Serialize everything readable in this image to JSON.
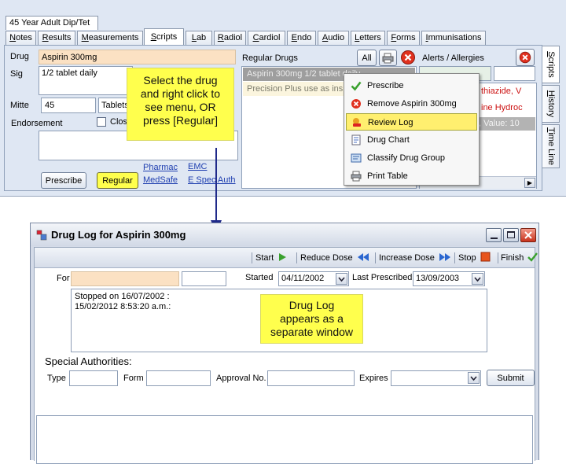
{
  "patient_tab": "45 Year Adult Dip/Tet",
  "clinical_tabs": [
    {
      "label": "Notes",
      "active": false
    },
    {
      "label": "Results",
      "active": false
    },
    {
      "label": "Measurements",
      "active": false
    },
    {
      "label": "Scripts",
      "active": true
    },
    {
      "label": "Lab",
      "active": false
    },
    {
      "label": "Radiol",
      "active": false
    },
    {
      "label": "Cardiol",
      "active": false
    },
    {
      "label": "Endo",
      "active": false
    },
    {
      "label": "Audio",
      "active": false
    },
    {
      "label": "Letters",
      "active": false
    },
    {
      "label": "Forms",
      "active": false
    },
    {
      "label": "Immunisations",
      "active": false
    }
  ],
  "side_tabs": [
    "Scripts",
    "History",
    "Time Line"
  ],
  "script_form": {
    "drug_label": "Drug",
    "drug_value": "Aspirin  300mg",
    "sig_label": "Sig",
    "sig_value": "1/2 tablet daily",
    "mitte_label": "Mitte",
    "mitte_value": "45",
    "unit_value": "Tablets",
    "endorsement_label": "Endorsement",
    "close_label": "Clos",
    "prescribe_button": "Prescribe",
    "regular_button": "Regular",
    "links": [
      "Pharmac",
      "MedSafe",
      "EMC",
      "E Spec Auth"
    ]
  },
  "regular_drugs": {
    "header": "Regular Drugs",
    "all_button": "All",
    "rows": [
      "Aspirin  300mg 1/2 tablet daily",
      "Precision Plus use as ins"
    ]
  },
  "alerts": {
    "header": "Alerts / Allergies",
    "rows": [
      "thiazide, V",
      "ine Hydroc",
      ", Value: 10"
    ]
  },
  "context_menu": {
    "items": [
      {
        "label": "Prescribe",
        "icon": "check-icon",
        "highlighted": false
      },
      {
        "label": "Remove Aspirin  300mg",
        "icon": "remove-icon",
        "highlighted": false
      },
      {
        "label": "Review Log",
        "icon": "review-log-icon",
        "highlighted": true
      },
      {
        "label": "Drug Chart",
        "icon": "drug-chart-icon",
        "highlighted": false
      },
      {
        "label": "Classify Drug Group",
        "icon": "classify-icon",
        "highlighted": false
      },
      {
        "label": "Print Table",
        "icon": "printer-icon",
        "highlighted": false
      }
    ]
  },
  "callouts": {
    "top": [
      "Select the drug",
      "and right click to",
      "see menu, OR",
      "press [Regular]"
    ],
    "bottom": [
      "Drug Log",
      "appears as a",
      "separate window"
    ]
  },
  "drug_log": {
    "title": "Drug Log for Aspirin  300mg",
    "toolbar": {
      "start": "Start",
      "reduce_dose": "Reduce Dose",
      "increase_dose": "Increase Dose",
      "stop": "Stop",
      "finish": "Finish"
    },
    "for_label": "For",
    "started_label": "Started",
    "started_value": "04/11/2002",
    "last_prescribed_label": "Last Prescribed",
    "last_prescribed_value": "13/09/2003",
    "log_lines": [
      "Stopped  on 16/07/2002 :",
      "15/02/2012 8:53:20 a.m.:"
    ],
    "special_authorities": {
      "heading": "Special Authorities:",
      "type_label": "Type",
      "form_label": "Form",
      "approval_label": "Approval No.",
      "expires_label": "Expires",
      "submit_button": "Submit"
    }
  },
  "colors": {
    "panel_bg": "#dfe7f3",
    "drug_field_bg": "#fbe1c3",
    "callout_bg": "#ffff4d",
    "menu_highlight": "#ffef6f",
    "alert_text": "#cc1111",
    "selected_row_bg": "#9e9e9e"
  }
}
